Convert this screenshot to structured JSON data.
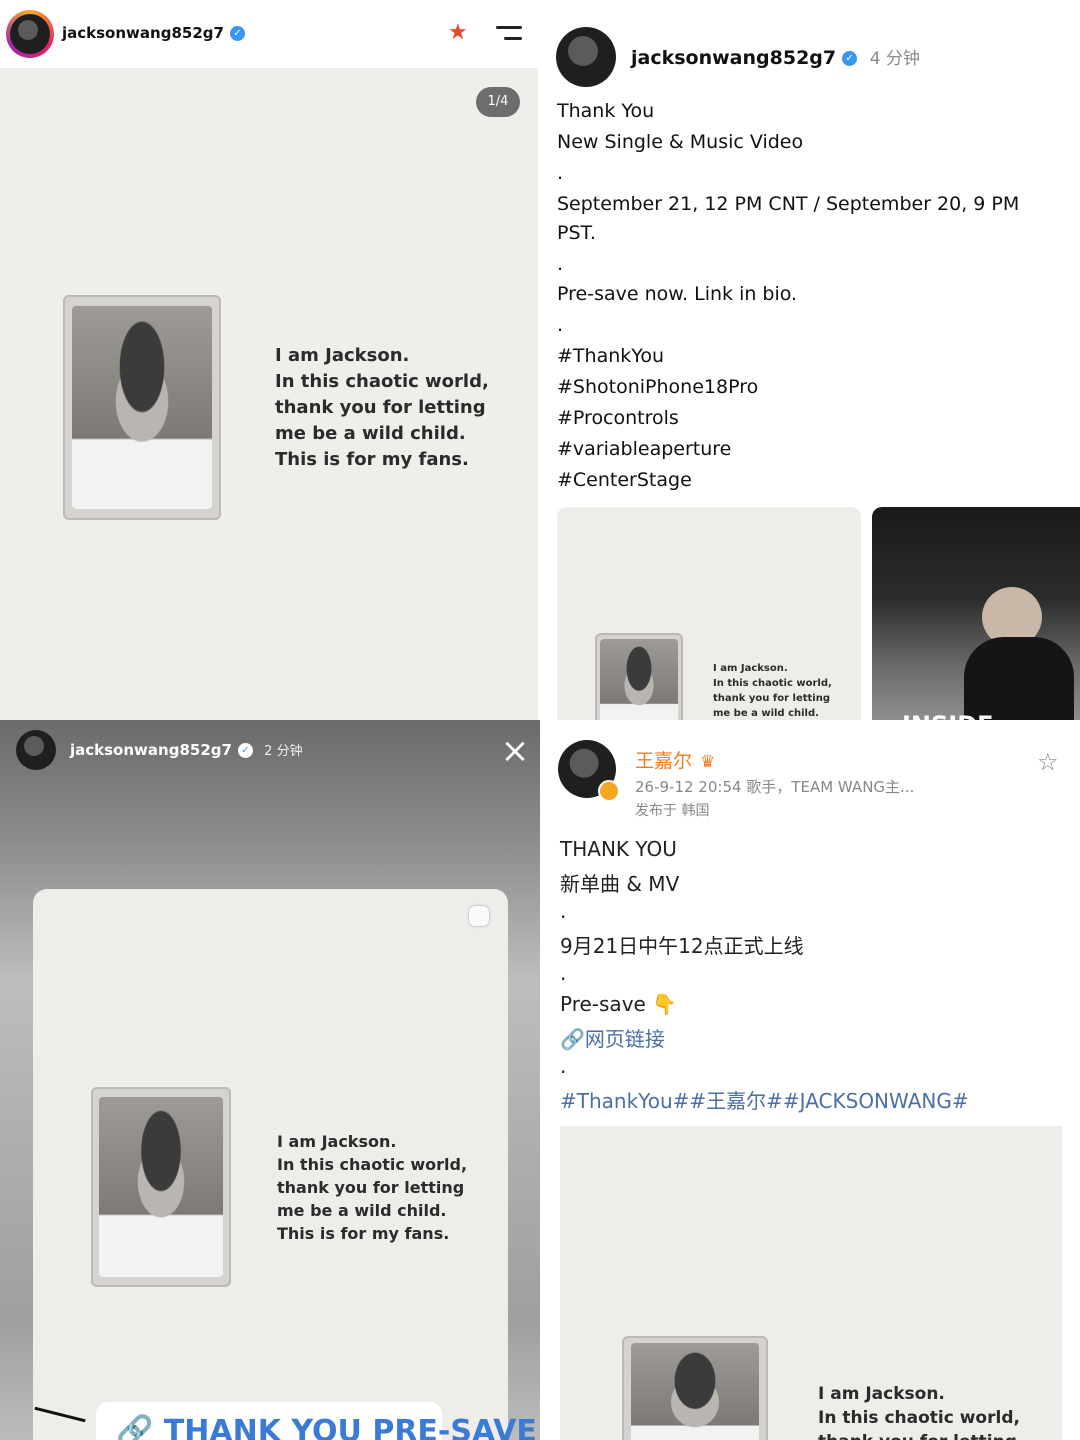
{
  "ig_post": {
    "username": "jacksonwang852g7",
    "counter": "1/4",
    "card_lines": [
      "I am Jackson.",
      "In this chaotic world,",
      "thank you for letting",
      "me be a wild child.",
      "This is for my fans."
    ]
  },
  "caption": {
    "username": "jacksonwang852g7",
    "time": "4 分钟",
    "lines": [
      "Thank You",
      "New Single & Music Video",
      ".",
      "September 21, 12 PM CNT / September 20, 9 PM",
      "PST.",
      ".",
      "Pre-save now. Link in bio.",
      ".",
      "#ThankYou",
      "#ShotoniPhone18Pro",
      "#Procontrols",
      "#variableaperture",
      "#CenterStage"
    ],
    "thumb_lines": [
      "I am Jackson.",
      "In this chaotic world,",
      "thank you for letting",
      "me be a wild child."
    ],
    "thumb2_text": "INSIDE"
  },
  "story": {
    "username": "jacksonwang852g7",
    "time": "2 分钟",
    "close": "×",
    "card_lines": [
      "I am Jackson.",
      "In this chaotic world,",
      "thank you for letting",
      "me be a wild child.",
      "This is for my fans."
    ],
    "sticker": "🔗 THANK YOU PRE-SAVE"
  },
  "weibo": {
    "name": "王嘉尔",
    "meta": "26-9-12 20:54  歌手，TEAM WANG主...",
    "location": "发布于 韩国",
    "lines": [
      "THANK YOU",
      "新单曲 & MV",
      ".",
      "9月21日中午12点正式上线",
      ".",
      "Pre-save 👇"
    ],
    "link": "网页链接",
    "dot": ".",
    "hashtags": "#ThankYou##王嘉尔##JACKSONWANG#",
    "card_lines": [
      "I am Jackson.",
      "In this chaotic world,",
      "thank you for letting"
    ]
  },
  "colors": {
    "link": "#4a6fa5",
    "weibo_name": "#f47b20",
    "verified": "#3897f0"
  }
}
